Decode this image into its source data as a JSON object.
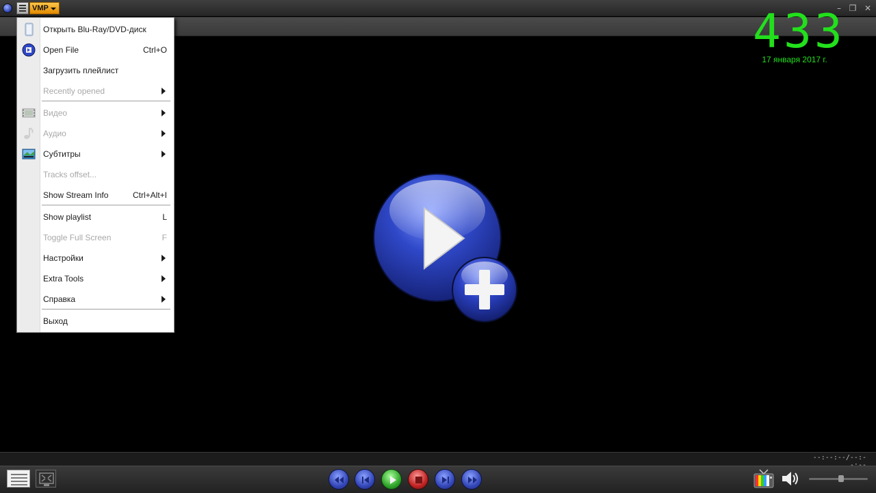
{
  "titlebar": {
    "vmp_label": "VMP"
  },
  "clock": {
    "time": "433",
    "date": "17 января 2017 г."
  },
  "menu": {
    "items": [
      {
        "label": "Открыть Blu-Ray/DVD-диск",
        "shortcut": "",
        "submenu": false,
        "disabled": false,
        "icon": "disc-icon"
      },
      {
        "label": "Open File",
        "shortcut": "Ctrl+O",
        "submenu": false,
        "disabled": false,
        "icon": "open-file-icon"
      },
      {
        "label": "Загрузить плейлист",
        "shortcut": "",
        "submenu": false,
        "disabled": false,
        "icon": ""
      },
      {
        "label": "Recently opened",
        "shortcut": "",
        "submenu": true,
        "disabled": true,
        "icon": ""
      },
      {
        "label": "Видео",
        "shortcut": "",
        "submenu": true,
        "disabled": true,
        "icon": "video-icon"
      },
      {
        "label": "Аудио",
        "shortcut": "",
        "submenu": true,
        "disabled": true,
        "icon": "music-note-icon"
      },
      {
        "label": "Субтитры",
        "shortcut": "",
        "submenu": true,
        "disabled": false,
        "icon": "subtitles-icon"
      },
      {
        "label": "Tracks offset...",
        "shortcut": "",
        "submenu": false,
        "disabled": true,
        "icon": ""
      },
      {
        "label": "Show Stream Info",
        "shortcut": "Ctrl+Alt+I",
        "submenu": false,
        "disabled": false,
        "icon": ""
      },
      {
        "label": "Show playlist",
        "shortcut": "L",
        "submenu": false,
        "disabled": false,
        "icon": ""
      },
      {
        "label": "Toggle Full Screen",
        "shortcut": "F",
        "submenu": false,
        "disabled": true,
        "icon": ""
      },
      {
        "label": "Настройки",
        "shortcut": "",
        "submenu": true,
        "disabled": false,
        "icon": ""
      },
      {
        "label": "Extra Tools",
        "shortcut": "",
        "submenu": true,
        "disabled": false,
        "icon": ""
      },
      {
        "label": "Справка",
        "shortcut": "",
        "submenu": true,
        "disabled": false,
        "icon": ""
      },
      {
        "label": "Выход",
        "shortcut": "",
        "submenu": false,
        "disabled": false,
        "icon": ""
      }
    ]
  },
  "player": {
    "time_display": "--:--:--/--:--:--",
    "volume_level": 0.55,
    "controls": [
      "rewind-icon",
      "previous-icon",
      "play-icon",
      "stop-icon",
      "next-icon",
      "fast-forward-icon"
    ]
  },
  "colors": {
    "clock": "#22e01c",
    "accent": "#ffc64a",
    "play_blue": "#3447b8"
  }
}
